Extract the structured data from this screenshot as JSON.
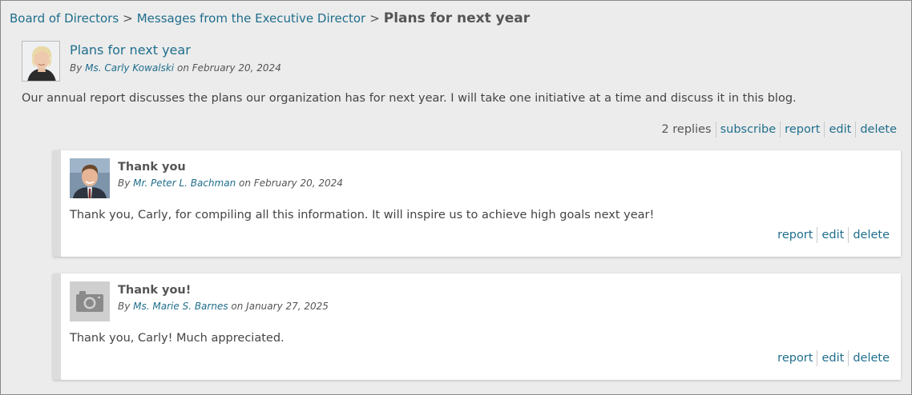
{
  "breadcrumb": {
    "items": [
      "Board of Directors",
      "Messages from the Executive Director"
    ],
    "separator": ">",
    "current": "Plans for next year"
  },
  "post": {
    "title": "Plans for next year",
    "by_prefix": "By",
    "author": "Ms. Carly Kowalski",
    "date_text": "on February 20, 2024",
    "body": "Our annual report discusses the plans our organization has for next year. I will take one initiative at a time and discuss it in this blog.",
    "replies_count": "2 replies",
    "actions": {
      "subscribe": "subscribe",
      "report": "report",
      "edit": "edit",
      "delete": "delete"
    }
  },
  "replies": [
    {
      "title": "Thank you",
      "by_prefix": "By",
      "author": "Mr. Peter L. Bachman",
      "date_text": "on February 20, 2024",
      "body": "Thank you, Carly, for compiling all this information. It will inspire us to achieve high goals next year!",
      "actions": {
        "report": "report",
        "edit": "edit",
        "delete": "delete"
      }
    },
    {
      "title": "Thank you!",
      "by_prefix": "By",
      "author": "Ms. Marie S. Barnes",
      "date_text": "on January 27, 2025",
      "body": "Thank you, Carly! Much appreciated.",
      "actions": {
        "report": "report",
        "edit": "edit",
        "delete": "delete"
      }
    }
  ],
  "colors": {
    "link": "#1f6e8c",
    "text": "#444444",
    "background": "#ececec",
    "card": "#ffffff"
  }
}
